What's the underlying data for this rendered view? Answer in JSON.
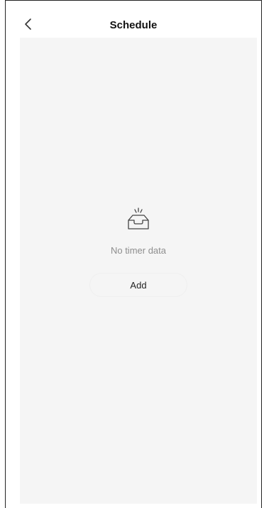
{
  "header": {
    "back_icon": "chevron-left-icon",
    "title": "Schedule"
  },
  "empty_state": {
    "icon": "empty-inbox-icon",
    "message": "No timer data",
    "add_label": "Add"
  }
}
